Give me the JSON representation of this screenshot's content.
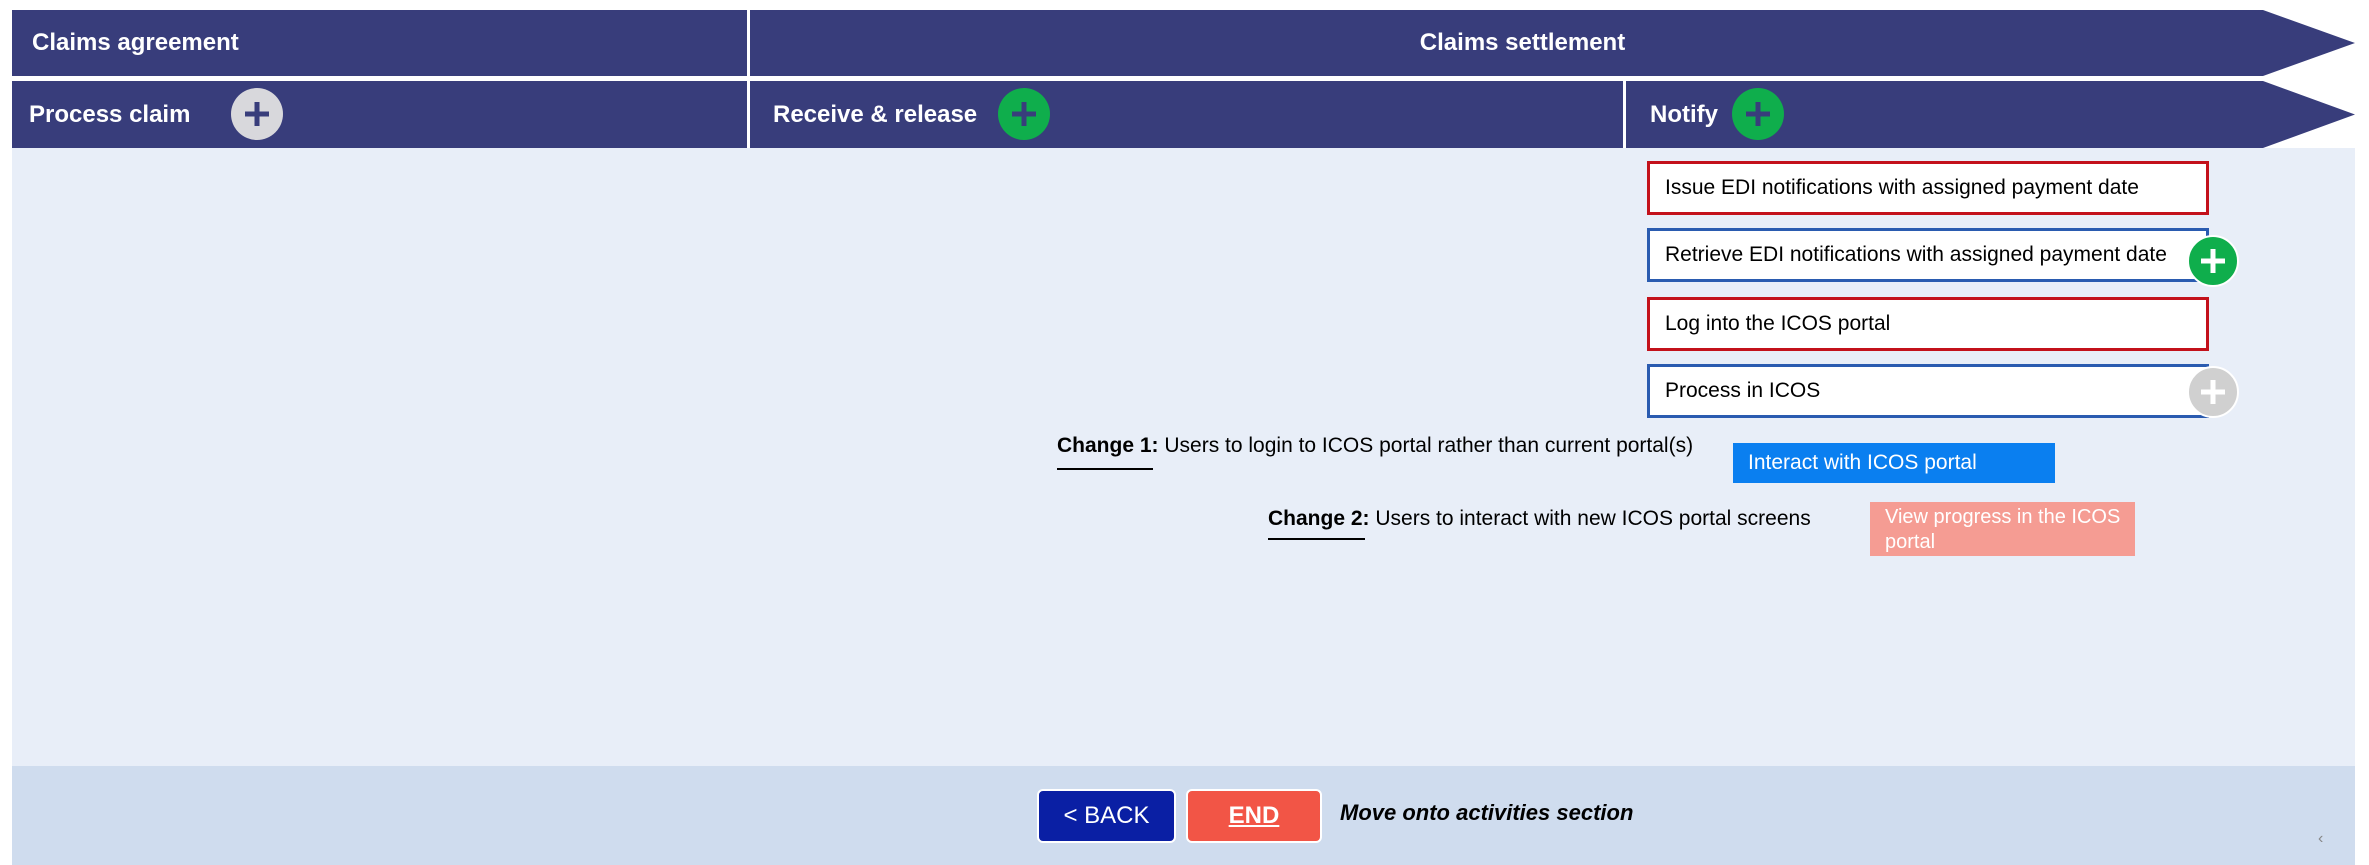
{
  "header": {
    "claims_agreement": "Claims agreement",
    "claims_settlement": "Claims settlement"
  },
  "stages": {
    "process_claim": "Process claim",
    "receive_release": "Receive & release",
    "notify": "Notify"
  },
  "notify_steps": [
    {
      "label": "Issue EDI notifications with assigned payment date",
      "border": "#c3111b"
    },
    {
      "label": "Retrieve EDI notifications with assigned payment date",
      "border": "#2a5bb0"
    },
    {
      "label": "Log into the ICOS portal",
      "border": "#c3111b"
    },
    {
      "label": "Process in ICOS",
      "border": "#2a5bb0"
    }
  ],
  "changes": [
    {
      "title": "Change 1:",
      "text": "Users to login to ICOS portal rather than current portal(s)"
    },
    {
      "title": "Change 2:",
      "text": "Users to interact with new ICOS portal screens"
    }
  ],
  "actions": {
    "interact": "Interact with ICOS portal",
    "view_progress": "View  progress in the ICOS portal"
  },
  "footer": {
    "back": "< BACK",
    "end": "END",
    "move_on": "Move onto activities section"
  },
  "colors": {
    "band": "#383d7b",
    "green": "#0fae4c",
    "red_border": "#c3111b",
    "blue_border": "#2a5bb0",
    "bright_blue": "#0a7ff0",
    "salmon": "#f59c93",
    "back_blue": "#0a1fa4",
    "end_red": "#f25546"
  },
  "icons": [
    "plus-icon"
  ]
}
